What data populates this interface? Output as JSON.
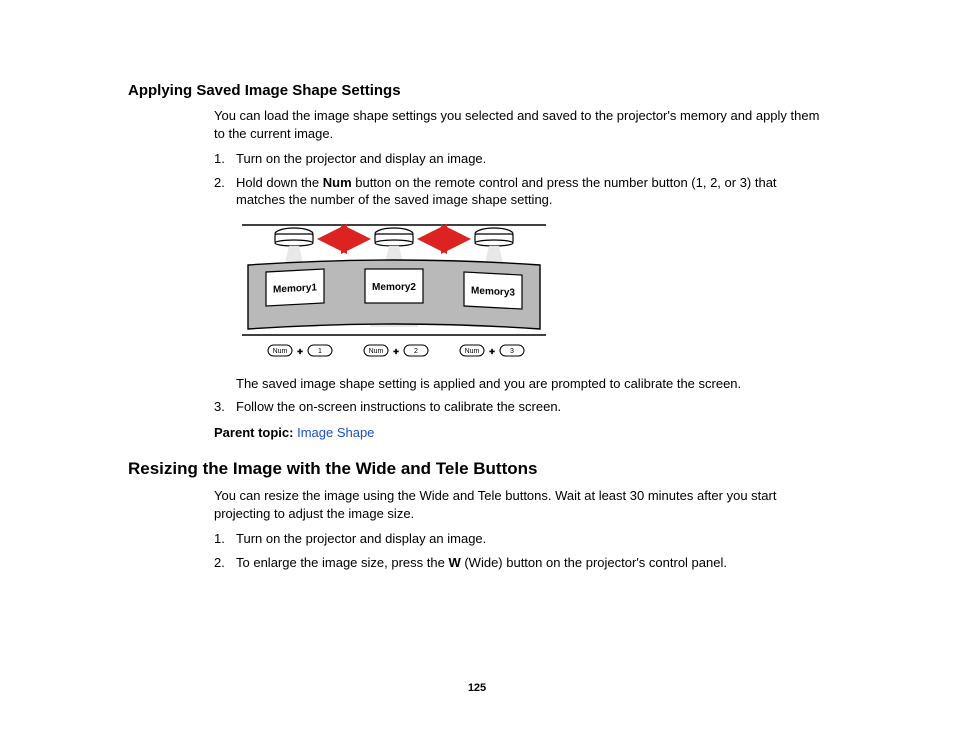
{
  "section1": {
    "heading": "Applying Saved Image Shape Settings",
    "intro": "You can load the image shape settings you selected and saved to the projector's memory and apply them to the current image.",
    "step1_num": "1.",
    "step1": "Turn on the projector and display an image.",
    "step2_num": "2.",
    "step2_pre": "Hold down the ",
    "step2_bold": "Num",
    "step2_post": " button on the remote control and press the number button (1, 2, or 3) that matches the number of the saved image shape setting.",
    "figure": {
      "memory1": "Memory1",
      "memory2": "Memory2",
      "memory3": "Memory3",
      "num": "Num",
      "b1": "1",
      "b2": "2",
      "b3": "3"
    },
    "after_figure": "The saved image shape setting is applied and you are prompted to calibrate the screen.",
    "step3_num": "3.",
    "step3": "Follow the on-screen instructions to calibrate the screen.",
    "parent_label": "Parent topic: ",
    "parent_link": "Image Shape"
  },
  "section2": {
    "heading": "Resizing the Image with the Wide and Tele Buttons",
    "intro": "You can resize the image using the Wide and Tele buttons. Wait at least 30 minutes after you start projecting to adjust the image size.",
    "step1_num": "1.",
    "step1": "Turn on the projector and display an image.",
    "step2_num": "2.",
    "step2_pre": "To enlarge the image size, press the ",
    "step2_bold": "W",
    "step2_post": " (Wide) button on the projector's control panel."
  },
  "page_number": "125"
}
